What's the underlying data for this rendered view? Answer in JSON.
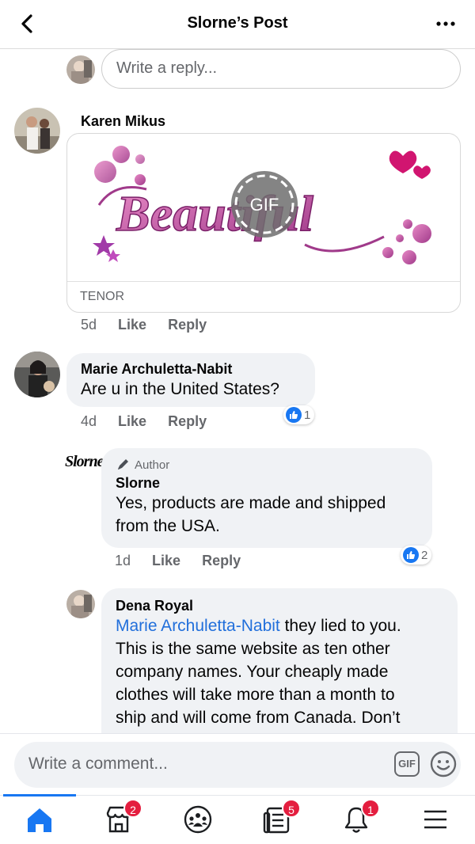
{
  "header": {
    "title": "Slorne’s Post"
  },
  "reply_box": {
    "placeholder": "Write a reply..."
  },
  "comments": [
    {
      "name": "Karen Mikus",
      "gif": {
        "word": "Beautiful",
        "badge": "GIF",
        "provider": "TENOR"
      },
      "time": "5d",
      "like": "Like",
      "reply": "Reply"
    },
    {
      "name": "Marie Archuletta-Nabit",
      "text": "Are u in the United States?",
      "reaction_count": "1",
      "time": "4d",
      "like": "Like",
      "reply": "Reply"
    },
    {
      "logo": "Slorne",
      "author_badge": "Author",
      "name": "Slorne",
      "text_line1": "Yes, products are made and shipped",
      "text_line2": "from the USA.",
      "reaction_count": "2",
      "time": "1d",
      "like": "Like",
      "reply": "Reply"
    },
    {
      "name": "Dena Royal",
      "mention": "Marie Archuletta-Nabit",
      "line1_rest": " they lied to you.",
      "line2": "This is the same website as ten other",
      "line3": "company names. Your cheaply made",
      "line4": "clothes will take more than a month to",
      "line5": "ship and will come from Canada. Don’t"
    }
  ],
  "comment_bar": {
    "placeholder": "Write a comment...",
    "gif_label": "GIF"
  },
  "nav": {
    "marketplace_badge": "2",
    "feeds_badge": "5",
    "notifications_badge": "1"
  },
  "colors": {
    "accent": "#1877f2",
    "badge": "#e41e3f",
    "bubble": "#f0f2f5",
    "mention": "#216fdb"
  },
  "icons": [
    "back-arrow-icon",
    "more-dots-icon",
    "home-icon",
    "marketplace-icon",
    "groups-icon",
    "feeds-icon",
    "bell-icon",
    "menu-icon",
    "gif-icon",
    "emoji-icon",
    "pen-icon",
    "thumbs-up-icon"
  ]
}
